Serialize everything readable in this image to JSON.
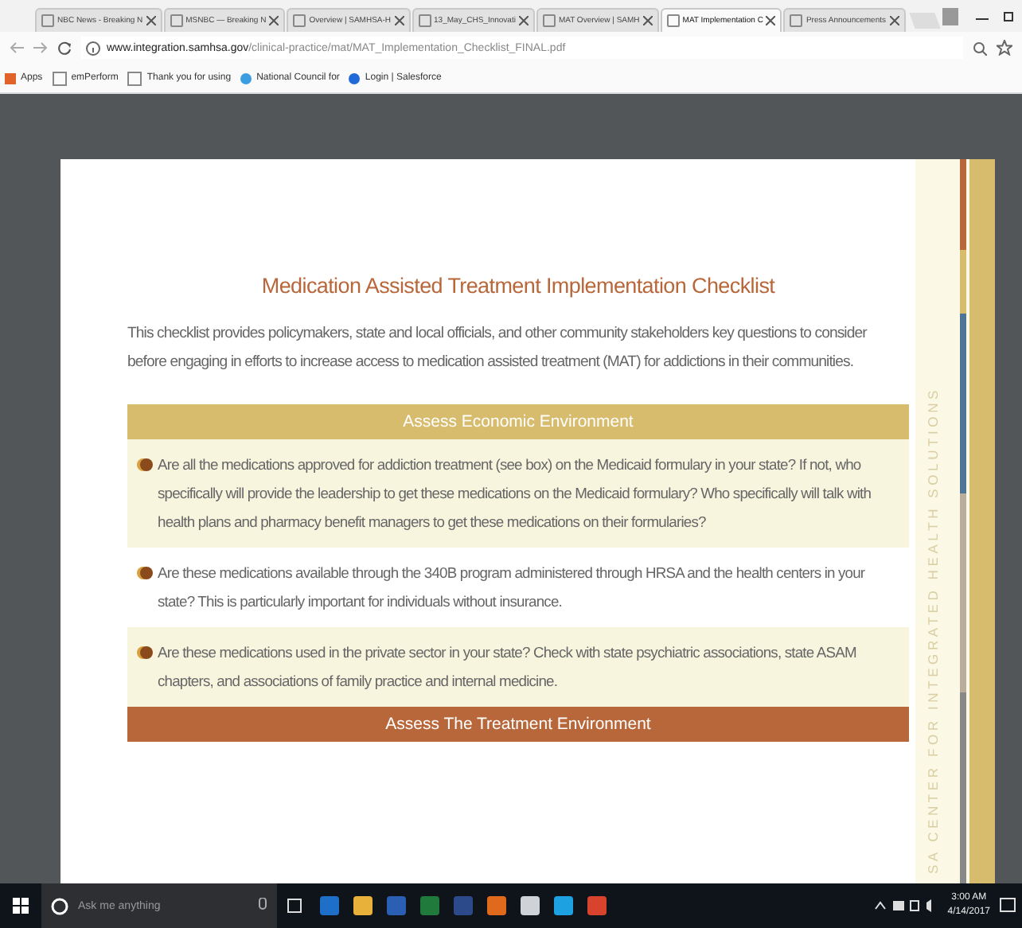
{
  "browser": {
    "tabs": [
      {
        "label": "NBC News - Breaking N",
        "selected": false
      },
      {
        "label": "MSNBC — Breaking N",
        "selected": false
      },
      {
        "label": "Overview | SAMHSA-H",
        "selected": false
      },
      {
        "label": "13_May_CHS_Innovati",
        "selected": false
      },
      {
        "label": "MAT Overview | SAMH",
        "selected": false
      },
      {
        "label": "MAT Implementation C",
        "selected": true
      },
      {
        "label": "Press Announcements",
        "selected": false
      }
    ],
    "url_host": "www.integration.samhsa.gov",
    "url_path": "/clinical-practice/mat/MAT_Implementation_Checklist_FINAL.pdf",
    "bookmarks": [
      "Apps",
      "emPerform",
      "Thank you for using",
      "National Council for",
      "Login | Salesforce"
    ]
  },
  "document": {
    "title": "Medication Assisted Treatment Implementation Checklist",
    "intro": "This checklist provides policymakers, state and local officials, and other community stakeholders  key questions to consider before engaging in efforts to increase access to medication assisted treatment (MAT) for addictions in their communities.",
    "sections": [
      {
        "heading": "Assess Economic Environment",
        "color": "#d8bc6e",
        "items": [
          "Are all the medications approved for addiction treatment (see box) on the Medicaid formulary in your state? If not, who specifically will provide the leadership to get these medications on the Medicaid formulary? Who specifically will talk with health plans and pharmacy benefit managers to get these medications on their formularies?",
          "Are these medications available through the 340B program administered through HRSA and the health centers in your state? This is particularly important for individuals without insurance.",
          "Are these medications used in the private sector in your state? Check with state psychiatric associations, state ASAM chapters, and associations of family practice and internal medicine."
        ]
      },
      {
        "heading": "Assess The Treatment Environment",
        "color": "#b8673a"
      }
    ],
    "sidebar_text": "SA CENTER FOR INTEGRATED HEALTH SOLUTIONS"
  },
  "taskbar": {
    "search_placeholder": "Ask me anything",
    "time": "3:00 AM",
    "date": "4/14/2017"
  }
}
